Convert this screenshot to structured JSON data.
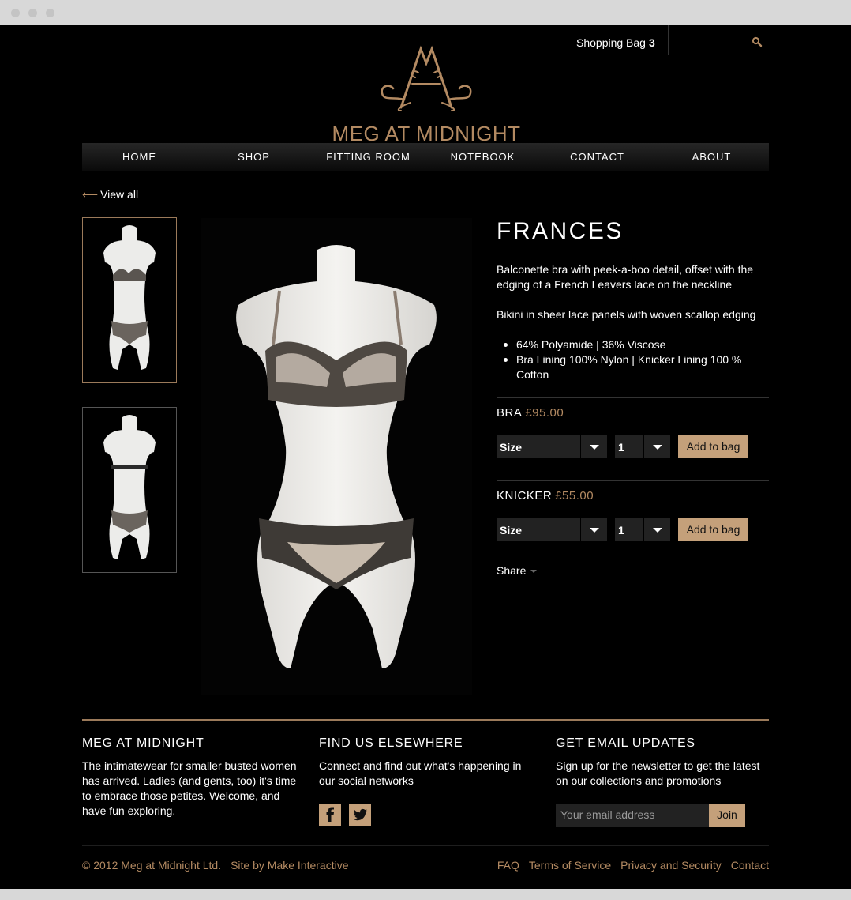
{
  "header": {
    "shopping_bag_label": "Shopping Bag",
    "shopping_bag_count": "3",
    "brand_name": "MEG AT MIDNIGHT"
  },
  "nav": {
    "items": [
      {
        "label": "HOME"
      },
      {
        "label": "SHOP"
      },
      {
        "label": "FITTING ROOM"
      },
      {
        "label": "NOTEBOOK"
      },
      {
        "label": "CONTACT"
      },
      {
        "label": "ABOUT"
      }
    ]
  },
  "breadcrumb": {
    "arrow": "⟵",
    "view_all_label": "View all"
  },
  "product": {
    "name": "FRANCES",
    "description_1": "Balconette bra with peek-a-boo detail, offset with the edging of a French Leavers lace on the neckline",
    "description_2": "Bikini in sheer lace panels with woven scallop edging",
    "features": [
      "64% Polyamide  |  36% Viscose",
      "Bra Lining 100% Nylon  | Knicker Lining 100 % Cotton"
    ],
    "items": [
      {
        "label": "BRA",
        "price": "£95.00",
        "size_label": "Size",
        "qty": "1",
        "add_label": "Add to bag"
      },
      {
        "label": "KNICKER",
        "price": "£55.00",
        "size_label": "Size",
        "qty": "1",
        "add_label": "Add to bag"
      }
    ],
    "share_label": "Share"
  },
  "footer": {
    "col1": {
      "title": "MEG AT MIDNIGHT",
      "text": "The intimatewear for smaller busted women has arrived. Ladies (and gents, too) it's time to embrace those petites. Welcome, and have fun exploring."
    },
    "col2": {
      "title": "FIND US ELSEWHERE",
      "text": "Connect and find out what's happening in our social networks"
    },
    "col3": {
      "title": "GET EMAIL UPDATES",
      "text": "Sign up for the newsletter to get the latest on our collections and promotions",
      "email_placeholder": "Your email address",
      "join_label": "Join"
    },
    "copyright": "© 2012 Meg at Midnight Ltd.",
    "credit": "Site by Make Interactive",
    "links": [
      {
        "label": "FAQ"
      },
      {
        "label": "Terms of Service"
      },
      {
        "label": "Privacy and Security"
      },
      {
        "label": "Contact"
      }
    ]
  },
  "colors": {
    "accent": "#c4a07a",
    "accent_text": "#b38a62",
    "background": "#000000"
  },
  "icons": [
    "search-icon",
    "brand-monogram-icon",
    "facebook-icon",
    "twitter-icon",
    "left-arrow-icon"
  ]
}
